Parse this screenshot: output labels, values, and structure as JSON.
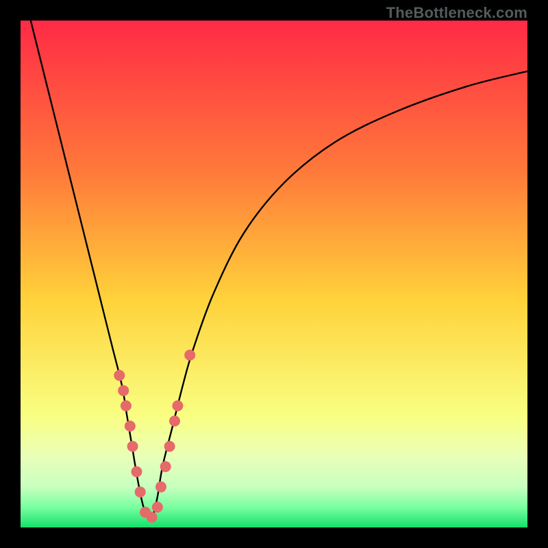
{
  "watermark": "TheBottleneck.com",
  "colors": {
    "frame": "#000000",
    "curve_stroke": "#000000",
    "dots_fill": "#e66a6a",
    "gradient_stops": [
      {
        "offset": 0.0,
        "color": "#ff2a46"
      },
      {
        "offset": 0.3,
        "color": "#ff7a3a"
      },
      {
        "offset": 0.55,
        "color": "#ffd23a"
      },
      {
        "offset": 0.78,
        "color": "#f9ff82"
      },
      {
        "offset": 0.86,
        "color": "#e9ffb8"
      },
      {
        "offset": 0.92,
        "color": "#c8ffbf"
      },
      {
        "offset": 0.96,
        "color": "#7affa0"
      },
      {
        "offset": 1.0,
        "color": "#14e06b"
      }
    ]
  },
  "chart_data": {
    "type": "line",
    "title": "",
    "xlabel": "",
    "ylabel": "",
    "xlim": [
      0,
      100
    ],
    "ylim": [
      0,
      100
    ],
    "grid": false,
    "legend": false,
    "series": [
      {
        "name": "bottleneck-curve",
        "x": [
          2,
          4,
          6,
          8,
          10,
          12,
          14,
          16,
          18,
          20,
          21,
          22,
          23,
          24,
          25,
          26,
          27,
          28,
          30,
          32,
          34,
          38,
          44,
          52,
          62,
          74,
          88,
          100
        ],
        "y": [
          100,
          92,
          84,
          76,
          68,
          60,
          52,
          44,
          36,
          28,
          22,
          16,
          10,
          5,
          2,
          2,
          6,
          12,
          20,
          28,
          35,
          46,
          58,
          68,
          76,
          82,
          87,
          90
        ]
      }
    ],
    "scatter_points": {
      "name": "highlight-dots",
      "x": [
        19.5,
        20.3,
        20.8,
        21.6,
        22.1,
        22.9,
        23.6,
        24.6,
        25.9,
        27.0,
        27.7,
        28.6,
        29.4,
        30.4,
        31.0,
        33.4
      ],
      "y": [
        30,
        27,
        24,
        20,
        16,
        11,
        7,
        3,
        2,
        4,
        8,
        12,
        16,
        21,
        24,
        34
      ]
    }
  }
}
